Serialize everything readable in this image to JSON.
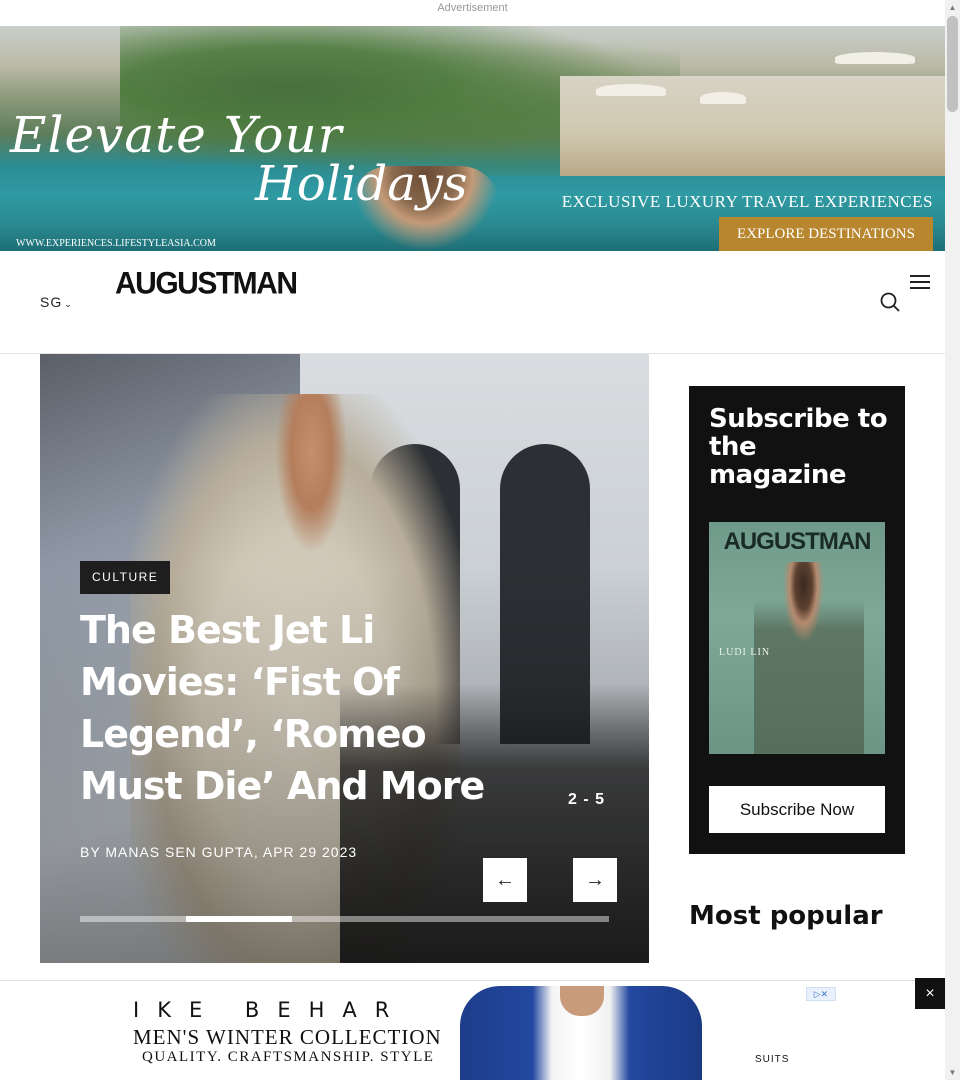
{
  "ads": {
    "top_label": "Advertisement",
    "top": {
      "script_line1": "Elevate Your",
      "script_line2": "Holidays",
      "tagline": "EXCLUSIVE LUXURY TRAVEL EXPERIENCES",
      "cta": "EXPLORE DESTINATIONS",
      "url": "WWW.EXPERIENCES.LIFESTYLEASIA.COM"
    },
    "bottom": {
      "brand": "IKE BEHAR",
      "line1": "MEN'S WINTER COLLECTION",
      "line2": "QUALITY. CRAFTSMANSHIP. STYLE",
      "cta": "SUITS",
      "close": "×",
      "adchoice": "▷✕"
    }
  },
  "header": {
    "region": "SG",
    "region_chevron": "⌄",
    "logo": "AUGUSTMAN"
  },
  "hero": {
    "category": "CULTURE",
    "title": "The Best Jet Li Movies: ‘Fist Of Legend’, ‘Romeo Must Die’ And More",
    "byline": "BY MANAS SEN GUPTA, APR 29 2023",
    "counter": "2 - 5",
    "prev_arrow": "←",
    "next_arrow": "→",
    "progress": {
      "current": 2,
      "total": 5
    }
  },
  "sidebar": {
    "subscribe_title": "Subscribe to the magazine",
    "cover_masthead": "AUGUSTMAN",
    "cover_name": "LUDI LIN",
    "subscribe_button": "Subscribe Now",
    "most_popular": "Most popular"
  },
  "colors": {
    "accent": "#111111",
    "cta_gold": "#b8862f"
  }
}
